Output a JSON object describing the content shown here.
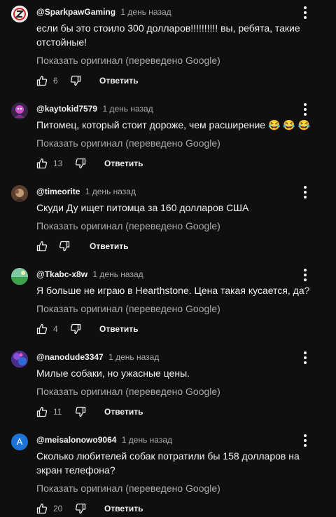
{
  "ui": {
    "translate_label": "Показать оригинал (переведено Google)",
    "reply_label": "Ответить"
  },
  "comments": [
    {
      "author": "@SparkpawGaming",
      "time": "1 день назад",
      "text": "если бы это стоило 300 долларов!!!!!!!!!! вы, ребята, такие отстойные!",
      "likes": "6",
      "avatar_icon": "sparkpaw-logo-avatar",
      "translated": true
    },
    {
      "author": "@kaytokid7579",
      "time": "1 день назад",
      "text": "Питомец, который стоит дороже, чем расширение 😂 😂 😂",
      "likes": "13",
      "avatar_icon": "kaytokid-avatar",
      "translated": true
    },
    {
      "author": "@timeorite",
      "time": "1 день назад",
      "text": "Скуди Ду ищет питомца за 160 долларов США",
      "likes": "",
      "avatar_icon": "timeorite-avatar",
      "translated": true
    },
    {
      "author": "@Tkabc-x8w",
      "time": "1 день назад",
      "text": "Я больше не играю в Hearthstone. Цена такая кусается, да?",
      "likes": "4",
      "avatar_icon": "tkabc-avatar",
      "translated": true
    },
    {
      "author": "@nanodude3347",
      "time": "1 день назад",
      "text": "Милые собаки, но ужасные цены.",
      "likes": "11",
      "avatar_icon": "nanodude-avatar",
      "translated": true
    },
    {
      "author": "@meisalonowo9064",
      "time": "1 день назад",
      "text": "Сколько любителей собак потратили бы 158 долларов на экран телефона?",
      "likes": "20",
      "avatar_icon": "letter-a-avatar",
      "avatar_letter": "A",
      "translated": true
    }
  ],
  "colors": {
    "background": "#0f0f0f",
    "text": "#f1f1f1",
    "secondary": "#aaaaaa",
    "letter_avatar": "#1e74d6"
  }
}
